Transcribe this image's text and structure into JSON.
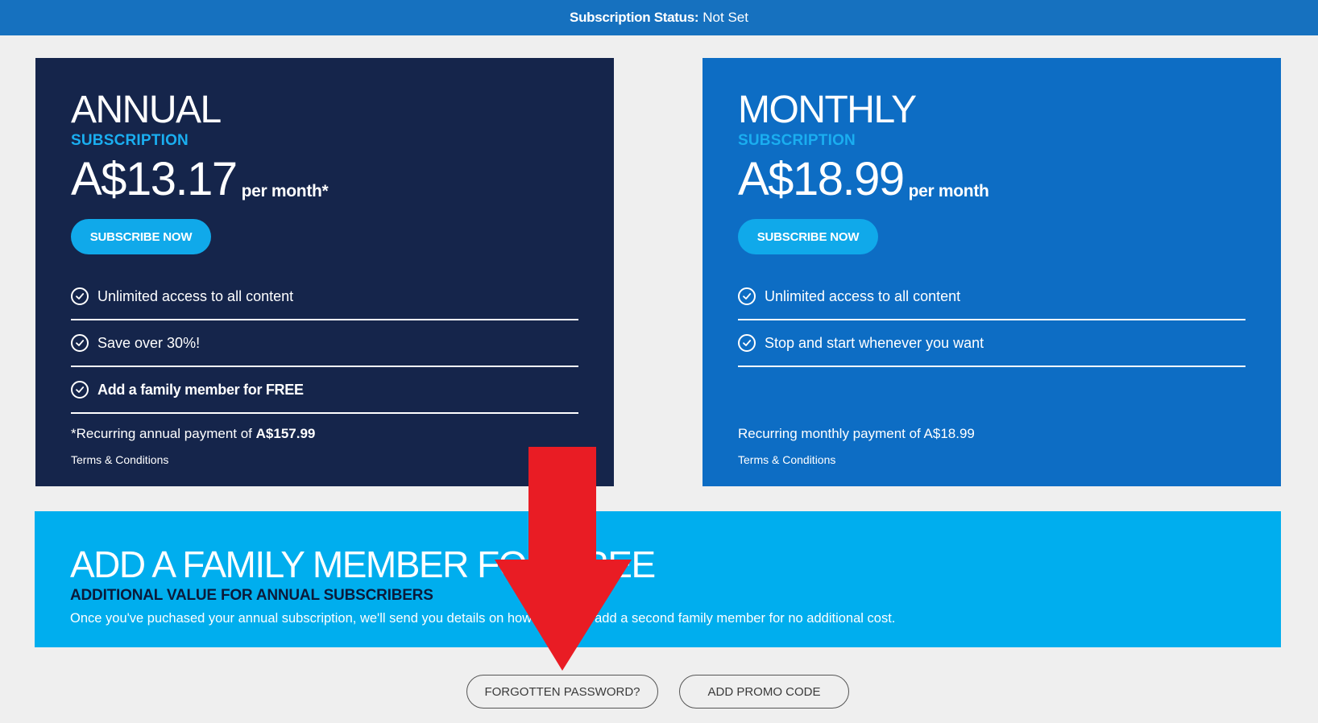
{
  "status_bar": {
    "label": "Subscription Status:",
    "value": "Not Set"
  },
  "plans": {
    "annual": {
      "name": "ANNUAL",
      "subtitle": "SUBSCRIPTION",
      "price": "A$13.17",
      "price_suffix": "per month*",
      "cta_label": "SUBSCRIBE NOW",
      "features": [
        "Unlimited access to all content",
        "Save over 30%!",
        "Add a family member for FREE"
      ],
      "payment_note_prefix": "*Recurring annual payment of",
      "payment_note_amount": "A$157.99",
      "terms_label": "Terms & Conditions"
    },
    "monthly": {
      "name": "MONTHLY",
      "subtitle": "SUBSCRIPTION",
      "price": "A$18.99",
      "price_suffix": "per month",
      "cta_label": "SUBSCRIBE NOW",
      "features": [
        "Unlimited access to all content",
        "Stop and start whenever you want"
      ],
      "payment_note": "Recurring monthly payment of A$18.99",
      "terms_label": "Terms & Conditions"
    }
  },
  "family_banner": {
    "title": "ADD A FAMILY MEMBER FOR FREE",
    "subtitle": "ADDITIONAL VALUE FOR ANNUAL SUBSCRIBERS",
    "description": "Once you've puchased your annual subscription, we'll send you details on how to quickly add a second family member for no additional cost."
  },
  "buttons": {
    "forgot_password": "FORGOTTEN PASSWORD?",
    "promo_code": "ADD PROMO CODE"
  },
  "colors": {
    "status_bar": "#1671bf",
    "annual_card": "#15254b",
    "monthly_card": "#0d6dc4",
    "accent": "#10a9ea",
    "family_banner": "#00aeee",
    "arrow": "#e91c24"
  },
  "icons": {
    "feature": "check-circle-icon",
    "annotation": "red-down-arrow"
  }
}
